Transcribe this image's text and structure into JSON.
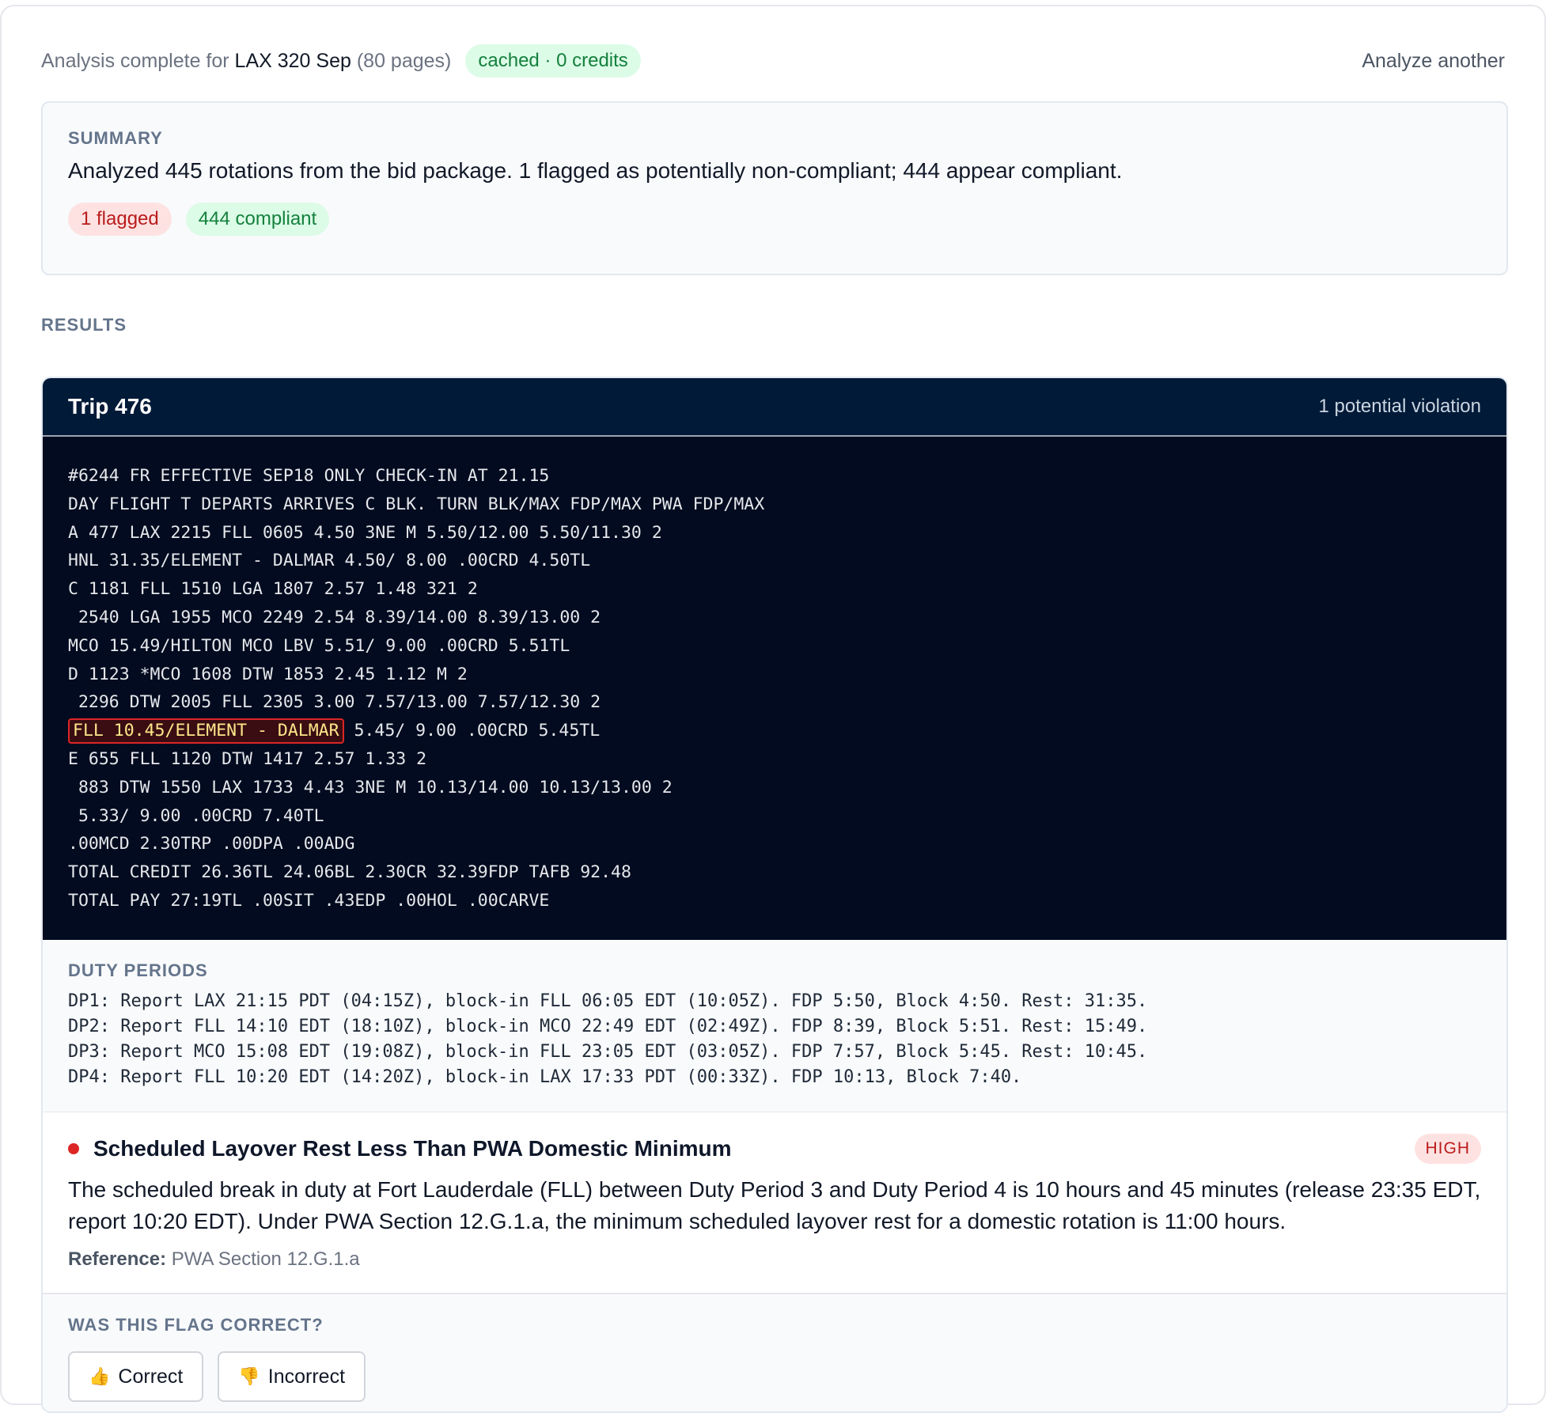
{
  "topbar": {
    "status_prefix": "Analysis complete for ",
    "package_name": "LAX 320 Sep",
    "pages": "(80 pages)",
    "cache_badge": "cached · 0 credits",
    "analyze_another": "Analyze another"
  },
  "summary": {
    "label": "SUMMARY",
    "text": "Analyzed 445 rotations from the bid package. 1 flagged as potentially non-compliant; 444 appear compliant.",
    "flagged": "1 flagged",
    "compliant": "444 compliant"
  },
  "results": {
    "label": "RESULTS"
  },
  "trip": {
    "title": "Trip 476",
    "violation_count": "1 potential violation",
    "lines": [
      "#6244 FR EFFECTIVE SEP18 ONLY CHECK-IN AT 21.15",
      "DAY FLIGHT T DEPARTS ARRIVES C BLK. TURN BLK/MAX FDP/MAX PWA FDP/MAX",
      "A 477 LAX 2215 FLL 0605 4.50 3NE M 5.50/12.00 5.50/11.30 2",
      "HNL 31.35/ELEMENT - DALMAR 4.50/ 8.00 .00CRD 4.50TL",
      "C 1181 FLL 1510 LGA 1807 2.57 1.48 321 2",
      " 2540 LGA 1955 MCO 2249 2.54 8.39/14.00 8.39/13.00 2",
      "MCO 15.49/HILTON MCO LBV 5.51/ 9.00 .00CRD 5.51TL",
      "D 1123 *MCO 1608 DTW 1853 2.45 1.12 M 2",
      " 2296 DTW 2005 FLL 2305 3.00 7.57/13.00 7.57/12.30 2"
    ],
    "highlight_text": "FLL 10.45/ELEMENT - DALMAR",
    "highlight_rest": " 5.45/ 9.00 .00CRD 5.45TL",
    "lines_after": [
      "E 655 FLL 1120 DTW 1417 2.57 1.33 2",
      " 883 DTW 1550 LAX 1733 4.43 3NE M 10.13/14.00 10.13/13.00 2",
      " 5.33/ 9.00 .00CRD 7.40TL",
      ".00MCD 2.30TRP .00DPA .00ADG",
      "TOTAL CREDIT 26.36TL 24.06BL 2.30CR 32.39FDP TAFB 92.48",
      "TOTAL PAY 27:19TL .00SIT .43EDP .00HOL .00CARVE"
    ]
  },
  "duty_periods": {
    "label": "DUTY PERIODS",
    "rows": [
      "DP1: Report LAX 21:15 PDT (04:15Z), block-in FLL 06:05 EDT (10:05Z). FDP 5:50, Block 4:50. Rest: 31:35.",
      "DP2: Report FLL 14:10 EDT (18:10Z), block-in MCO 22:49 EDT (02:49Z). FDP 8:39, Block 5:51. Rest: 15:49.",
      "DP3: Report MCO 15:08 EDT (19:08Z), block-in FLL 23:05 EDT (03:05Z). FDP 7:57, Block 5:45. Rest: 10:45.",
      "DP4: Report FLL 10:20 EDT (14:20Z), block-in LAX 17:33 PDT (00:33Z). FDP 10:13, Block 7:40."
    ]
  },
  "violation": {
    "title": "Scheduled Layover Rest Less Than PWA Domestic Minimum",
    "severity": "HIGH",
    "description": "The scheduled break in duty at Fort Lauderdale (FLL) between Duty Period 3 and Duty Period 4 is 10 hours and 45 minutes (release 23:35 EDT, report 10:20 EDT). Under PWA Section 12.G.1.a, the minimum scheduled layover rest for a domestic rotation is 11:00 hours.",
    "reference_label": "Reference:",
    "reference_value": " PWA Section 12.G.1.a"
  },
  "feedback": {
    "label": "WAS THIS FLAG CORRECT?",
    "correct_icon": "👍",
    "correct": "Correct",
    "incorrect_icon": "👎",
    "incorrect": "Incorrect"
  },
  "colors": {
    "header_bg": "#001a38",
    "code_bg": "#020b1f",
    "flag_red": "#dc2626",
    "compliant_green": "#15803d"
  }
}
